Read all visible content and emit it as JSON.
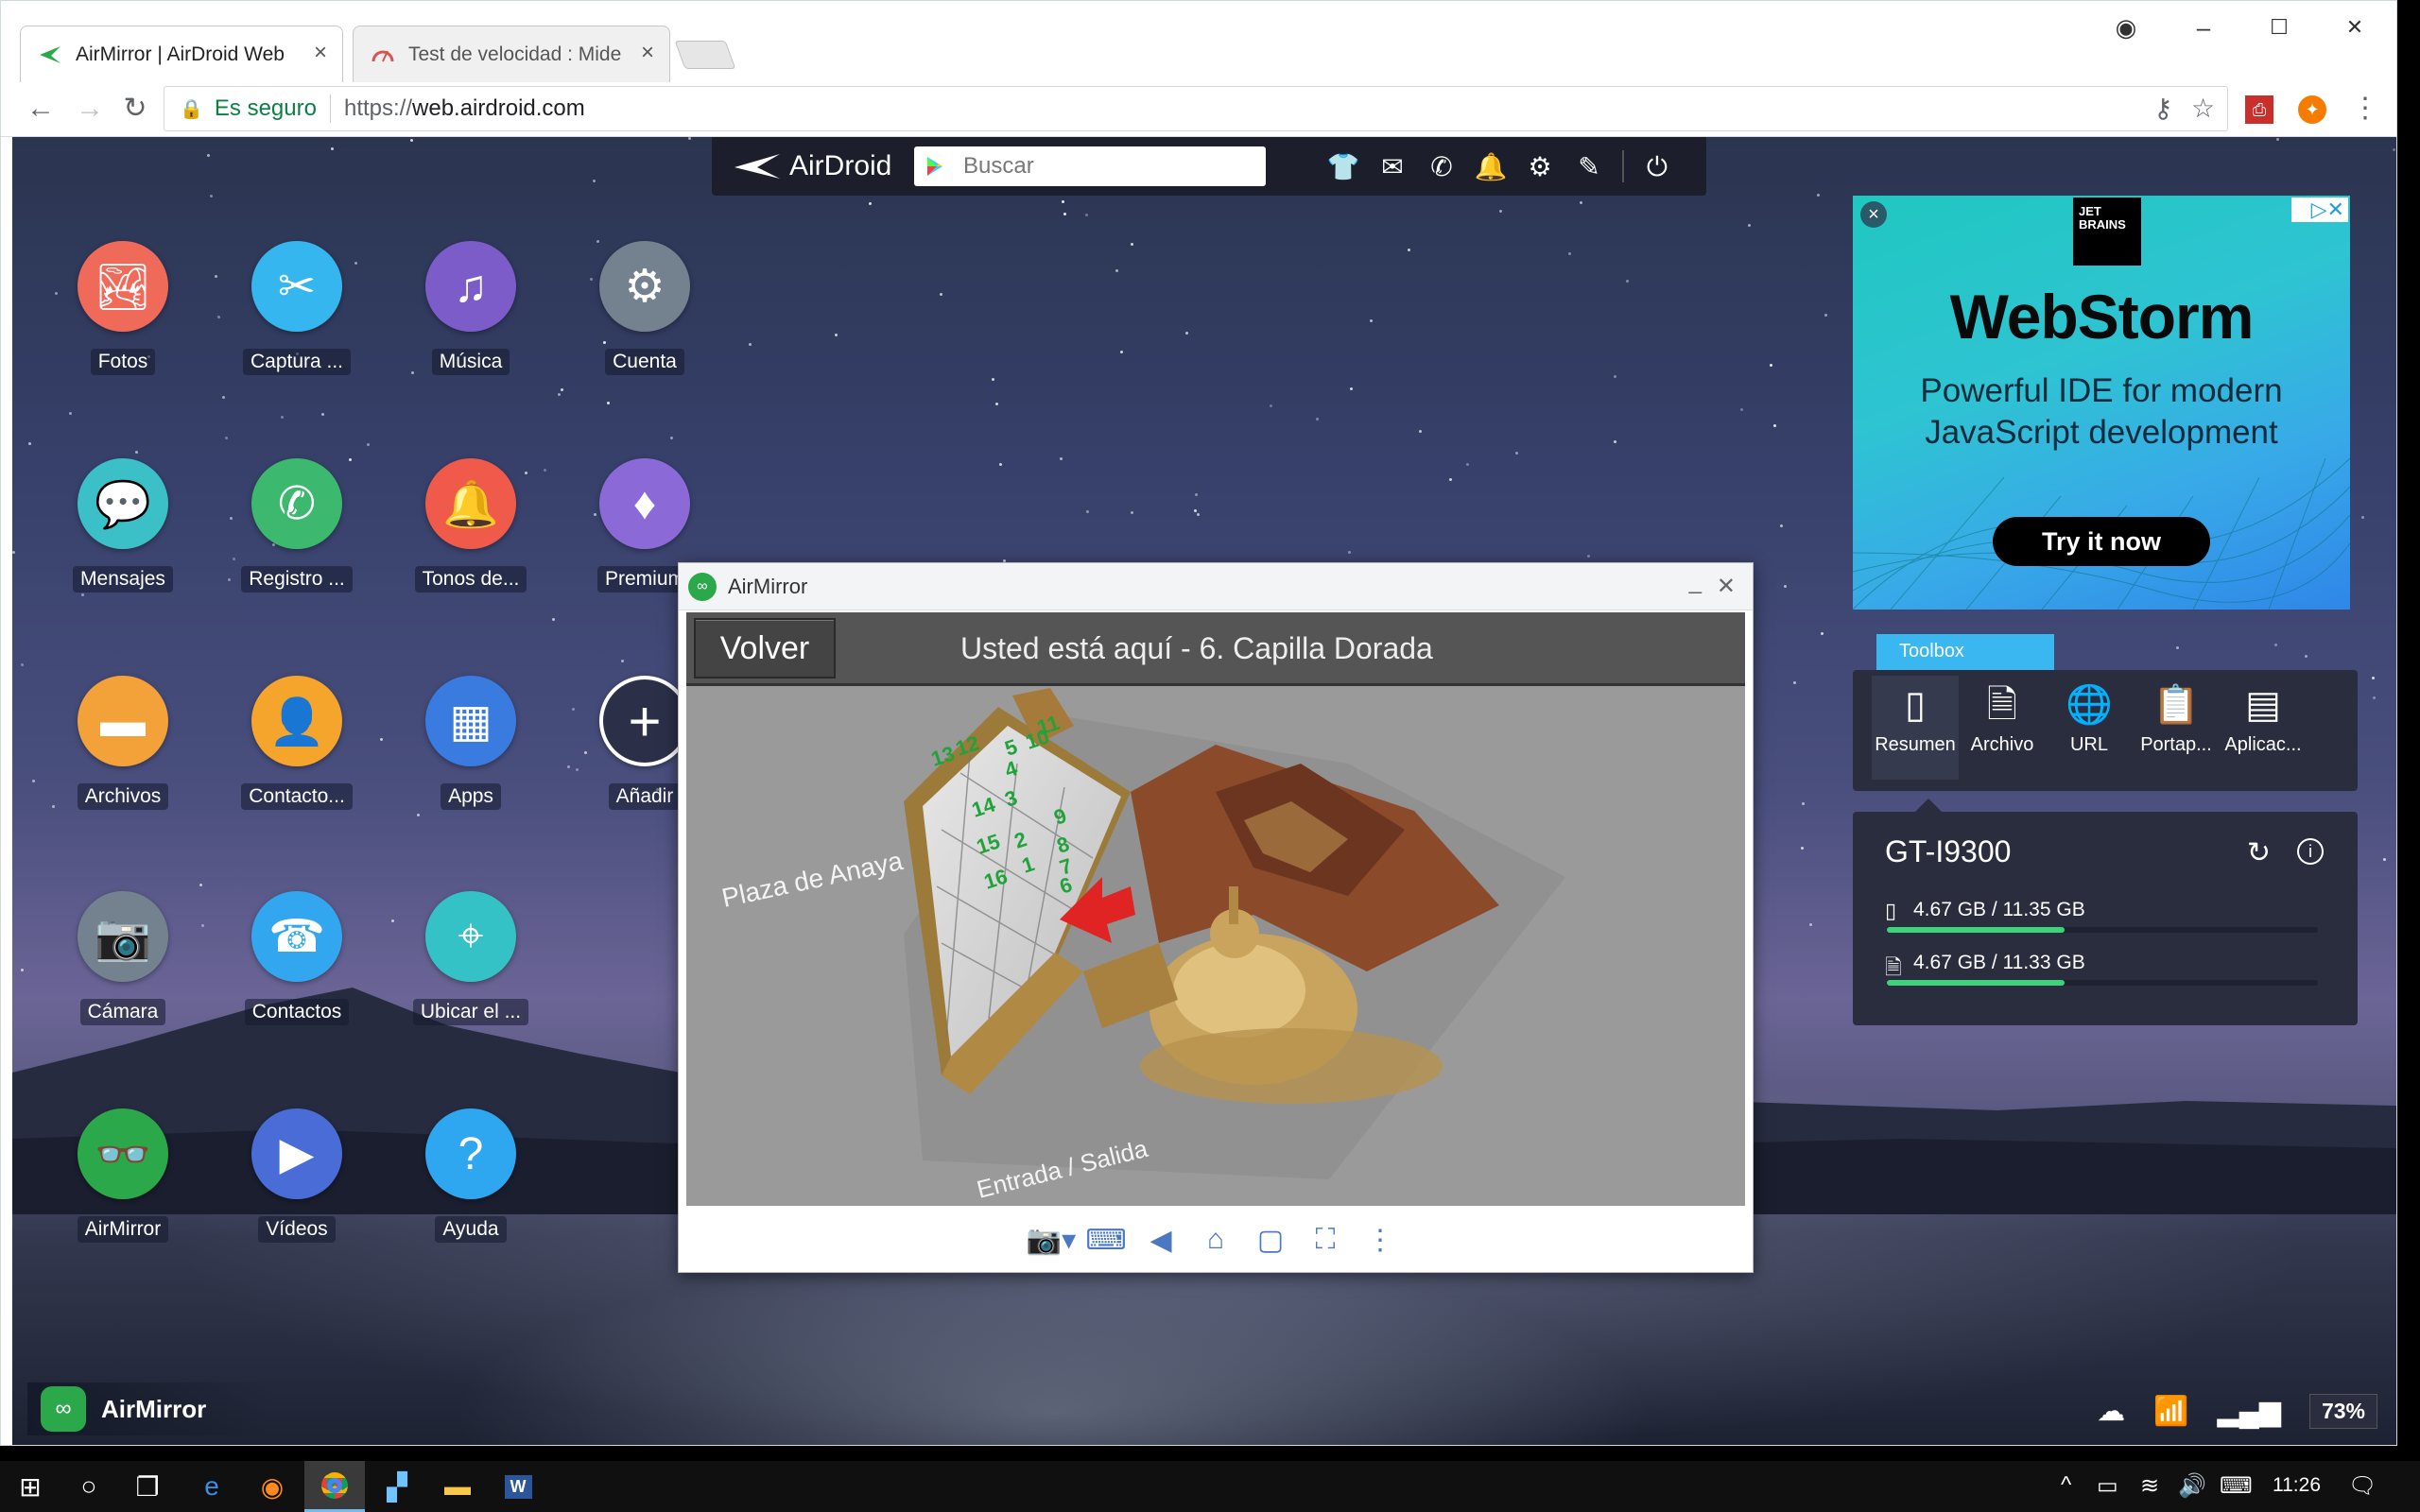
{
  "browser": {
    "tabs": [
      {
        "label": "AirMirror | AirDroid Web",
        "active": true
      },
      {
        "label": "Test de velocidad : Mide",
        "active": false
      }
    ],
    "window_controls": {
      "minimize": "–",
      "maximize": "☐",
      "close": "✕"
    },
    "nav": {
      "back": "←",
      "forward": "→",
      "reload": "↻"
    },
    "address": {
      "secure_label": "Es seguro",
      "scheme": "https://",
      "host": "web.airdroid.com"
    },
    "icons": {
      "key": "key-icon",
      "star": "star-icon",
      "menu": "menu-icon"
    }
  },
  "airdroid_bar": {
    "logo": "AirDroid",
    "search_placeholder": "Buscar",
    "icons": [
      "shirt-icon",
      "mail-icon",
      "phone-icon",
      "bell-icon",
      "gear-icon",
      "pen-icon",
      "power-icon"
    ]
  },
  "desktop_icons": [
    {
      "label": "Fotos",
      "color": "#f06a5a",
      "glyph": "🏞"
    },
    {
      "label": "Captura ...",
      "color": "#35b6ee",
      "glyph": "✂"
    },
    {
      "label": "Música",
      "color": "#7b5cc9",
      "glyph": "♫"
    },
    {
      "label": "Cuenta",
      "color": "#74828f",
      "glyph": "⚙"
    },
    {
      "label": "Mensajes",
      "color": "#3cc0c8",
      "glyph": "💬"
    },
    {
      "label": "Registro ...",
      "color": "#3cb96e",
      "glyph": "✆"
    },
    {
      "label": "Tonos de...",
      "color": "#ef5a4a",
      "glyph": "🔔"
    },
    {
      "label": "Premium",
      "color": "#8b6ad8",
      "glyph": "♦"
    },
    {
      "label": "Archivos",
      "color": "#f3a23a",
      "glyph": "▬"
    },
    {
      "label": "Contacto...",
      "color": "#f5a52c",
      "glyph": "👤"
    },
    {
      "label": "Apps",
      "color": "#3a7be0",
      "glyph": "▦"
    },
    {
      "label": "Añadir",
      "color": "#2b3048",
      "glyph": "+"
    },
    {
      "label": "Cámara",
      "color": "#74828f",
      "glyph": "📷"
    },
    {
      "label": "Contactos",
      "color": "#32a7ef",
      "glyph": "☎"
    },
    {
      "label": "Ubicar el ...",
      "color": "#35c2c6",
      "glyph": "⌖"
    },
    {
      "label": "AirMirror",
      "color": "#2ba84a",
      "glyph": "👓"
    },
    {
      "label": "Vídeos",
      "color": "#4a6cd6",
      "glyph": "▶"
    },
    {
      "label": "Ayuda",
      "color": "#2ea6f0",
      "glyph": "?"
    }
  ],
  "airmirror_window": {
    "title": "AirMirror",
    "minimize": "_",
    "close": "✕",
    "screen": {
      "back_button": "Volver",
      "header": "Usted está aquí - 6. Capilla Dorada",
      "map_labels": {
        "plaza": "Plaza de Anaya",
        "entrance": "Entrada / Salida"
      },
      "numbers": [
        "11",
        "13",
        "12",
        "5",
        "10",
        "4",
        "14",
        "3",
        "9",
        "15",
        "2",
        "8",
        "1",
        "7",
        "16",
        "6"
      ]
    },
    "tools": [
      "camera-icon",
      "keyboard-icon",
      "back-icon",
      "home-icon",
      "recents-icon",
      "fullscreen-icon",
      "more-icon"
    ]
  },
  "ad": {
    "brand": "JET BRAINS",
    "title": "WebStorm",
    "subtitle_line1": "Powerful IDE for modern",
    "subtitle_line2": "JavaScript development",
    "cta": "Try it now"
  },
  "toolbox": {
    "tab_label": "Toolbox",
    "items": [
      {
        "label": "Resumen",
        "glyph": "▯",
        "selected": true
      },
      {
        "label": "Archivo",
        "glyph": "🗎",
        "selected": false
      },
      {
        "label": "URL",
        "glyph": "🌐",
        "selected": false
      },
      {
        "label": "Portap...",
        "glyph": "📋",
        "selected": false
      },
      {
        "label": "Aplicac...",
        "glyph": "▤",
        "selected": false
      }
    ]
  },
  "device": {
    "name": "GT-I9300",
    "storage": [
      {
        "label": "4.67 GB / 11.35 GB",
        "used": 4.67,
        "total": 11.35,
        "icon": "phone-storage-icon"
      },
      {
        "label": "4.67 GB / 11.33 GB",
        "used": 4.67,
        "total": 11.33,
        "icon": "sd-card-icon"
      }
    ]
  },
  "bottom_bar": {
    "app_label": "AirMirror",
    "battery": "73%"
  },
  "taskbar": {
    "time": "11:26",
    "apps": [
      "windows-start-icon",
      "cortana-icon",
      "task-view-icon",
      "edge-icon",
      "firefox-icon",
      "chrome-icon",
      "app-icon",
      "file-explorer-icon",
      "word-icon"
    ]
  }
}
